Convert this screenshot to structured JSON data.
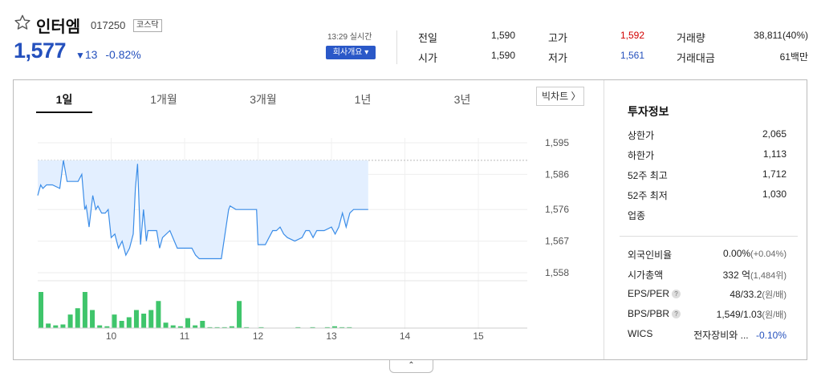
{
  "stock": {
    "name": "인터엠",
    "code": "017250",
    "market": "코스닥",
    "price": "1,577",
    "change_arrow": "▼",
    "change_amount": "13",
    "change_pct": "-0.82%"
  },
  "realtime": {
    "time": "13:29 실시간",
    "company_button": "회사개요 ▾"
  },
  "quotes": {
    "prev_close": {
      "label": "전일",
      "value": "1,590"
    },
    "open": {
      "label": "시가",
      "value": "1,590"
    },
    "high": {
      "label": "고가",
      "value": "1,592"
    },
    "low": {
      "label": "저가",
      "value": "1,561"
    },
    "volume": {
      "label": "거래량",
      "value": "38,811(40%)"
    },
    "trade_value": {
      "label": "거래대금",
      "value": "61백만"
    }
  },
  "tabs": [
    "1일",
    "1개월",
    "3개월",
    "1년",
    "3년"
  ],
  "big_chart": "빅차트 〉",
  "chart_data": {
    "type": "line",
    "x_labels": [
      "10",
      "11",
      "12",
      "13",
      "14",
      "15"
    ],
    "y_ticks": [
      "1,595",
      "1,586",
      "1,576",
      "1,567",
      "1,558"
    ],
    "y_tick_values": [
      1595,
      1586,
      1576,
      1567,
      1558
    ],
    "prev_close": 1590,
    "x": [
      9.0,
      9.04,
      9.07,
      9.12,
      9.2,
      9.3,
      9.35,
      9.4,
      9.45,
      9.55,
      9.6,
      9.64,
      9.66,
      9.7,
      9.75,
      9.79,
      9.82,
      9.87,
      9.92,
      9.96,
      10.0,
      10.05,
      10.1,
      10.15,
      10.2,
      10.25,
      10.3,
      10.33,
      10.36,
      10.4,
      10.44,
      10.48,
      10.5,
      10.55,
      10.58,
      10.62,
      10.66,
      10.7,
      10.8,
      10.9,
      11.0,
      11.05,
      11.1,
      11.15,
      11.2,
      11.25,
      11.3,
      11.4,
      11.5,
      11.6,
      11.62,
      11.7,
      11.8,
      11.9,
      11.98,
      12.0,
      12.05,
      12.1,
      12.15,
      12.2,
      12.25,
      12.3,
      12.35,
      12.4,
      12.5,
      12.6,
      12.65,
      12.7,
      12.75,
      12.8,
      12.9,
      13.0,
      13.05,
      13.1,
      13.15,
      13.2,
      13.25,
      13.3,
      13.35,
      13.4,
      13.5
    ],
    "values": [
      1580,
      1583,
      1582,
      1583,
      1583,
      1582,
      1590,
      1584,
      1584,
      1584,
      1586,
      1576,
      1577,
      1571,
      1580,
      1576,
      1577,
      1575,
      1575,
      1576,
      1568,
      1569,
      1565,
      1567,
      1563,
      1565,
      1569,
      1582,
      1589,
      1566,
      1576,
      1567,
      1570,
      1570,
      1570,
      1570,
      1565,
      1568,
      1570,
      1565,
      1565,
      1565,
      1565,
      1563,
      1562,
      1562,
      1562,
      1562,
      1562,
      1576,
      1577,
      1576,
      1576,
      1576,
      1576,
      1566,
      1566,
      1566,
      1568,
      1570,
      1570,
      1571,
      1569,
      1568,
      1567,
      1568,
      1570,
      1570,
      1568,
      1570,
      1570,
      1571,
      1569,
      1571,
      1575,
      1571,
      1575,
      1576,
      1576,
      1576,
      1576
    ],
    "volume_x": [
      9.0,
      9.1,
      9.2,
      9.3,
      9.4,
      9.5,
      9.6,
      9.7,
      9.8,
      9.9,
      10.0,
      10.1,
      10.2,
      10.3,
      10.4,
      10.5,
      10.6,
      10.7,
      10.8,
      10.9,
      11.0,
      11.1,
      11.2,
      11.3,
      11.4,
      11.5,
      11.6,
      11.7,
      11.8,
      12.0,
      12.3,
      12.5,
      12.7,
      12.9,
      13.0,
      13.1,
      13.2
    ],
    "volume": [
      40,
      5,
      3,
      4,
      15,
      22,
      40,
      20,
      3,
      2,
      15,
      8,
      12,
      20,
      16,
      20,
      30,
      6,
      3,
      2,
      11,
      3,
      8,
      1,
      1,
      1,
      2,
      30,
      1,
      1,
      0,
      1,
      1,
      1,
      2,
      1,
      1
    ]
  },
  "invest": {
    "title": "투자정보",
    "rows": [
      {
        "label": "상한가",
        "value": "2,065",
        "color": "#d20000"
      },
      {
        "label": "하한가",
        "value": "1,113",
        "color": "#2450bd"
      },
      {
        "label": "52주 최고",
        "value": "1,712"
      },
      {
        "label": "52주 최저",
        "value": "1,030"
      },
      {
        "label": "업종",
        "value": ""
      }
    ],
    "rows2": [
      {
        "label": "외국인비율",
        "value": "0.00%",
        "sub": "(+0.04%)"
      },
      {
        "label": "시가총액",
        "value": "332 억",
        "sub": "(1,484위)"
      },
      {
        "label": "EPS/PER",
        "value": "48/33.2",
        "sub": "(원/배)",
        "help": "?"
      },
      {
        "label": "BPS/PBR",
        "value": "1,549/1.03",
        "sub": "(원/배)",
        "help": "?"
      },
      {
        "label": "WICS",
        "value": "전자장비와 ...",
        "sub2": "-0.10%"
      }
    ]
  },
  "collapse_icon": "⌃"
}
